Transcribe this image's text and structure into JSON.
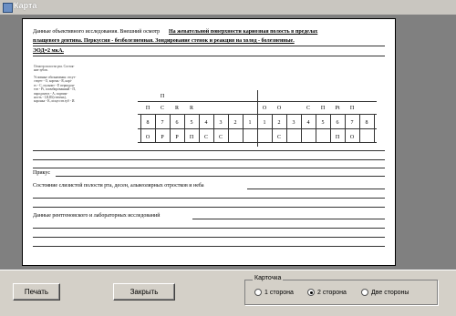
{
  "window": {
    "title": "Карта"
  },
  "card": {
    "exam_prefix": "Данные объективного исследования. Внешний осмотр",
    "exam_line1": "На жевательной поверхности кариозная полость в пределах",
    "exam_line2": "плащевого дентина. Перкуссия - безболезненная. Зондирование стенок и реакция на холод - болезненные.",
    "exam_line3": "ЭОД=2 мкА.",
    "legend_title": "Осмотр полости рта. Состоя-\nние зубов.",
    "legend_body": "Условные обозначения: отсут-\nствует - О, корень - R, карi-\nес - С, пульпит - Р, периодон-\nтит - Pt, пломбированный - П,\nпародонтоз - A, подвиж-\nность - I,II,III(степень),\nкоронка - K, искусств.зуб - И.",
    "teeth_top_status": [
      "",
      "П",
      "",
      "",
      "",
      "",
      "",
      "",
      "",
      "",
      "",
      "",
      "",
      "",
      "",
      ""
    ],
    "teeth_upper_status": [
      "П",
      "С",
      "R",
      "R",
      "",
      "",
      "",
      "",
      "О",
      "О",
      "",
      "С",
      "П",
      "Pt",
      "П",
      ""
    ],
    "teeth_numbers": [
      "8",
      "7",
      "6",
      "5",
      "4",
      "3",
      "2",
      "1",
      "1",
      "2",
      "3",
      "4",
      "5",
      "6",
      "7",
      "8"
    ],
    "teeth_lower_status": [
      "О",
      "Р",
      "Р",
      "П",
      "С",
      "С",
      "",
      "",
      "",
      "С",
      "",
      "",
      "",
      "П",
      "О",
      ""
    ],
    "bite_label": "Прикус",
    "mucosa_label": "Состояние слизистой полости рта, десен, альвеолярных отростков и неба",
    "xray_label": "Данные рентгеновского и лабораторных исследований"
  },
  "controls": {
    "print_label": "Печать",
    "close_label": "Закрыть",
    "card_group_label": "Карточка",
    "radio_options": [
      {
        "label": "1 сторона",
        "checked": false
      },
      {
        "label": "2 сторона",
        "checked": true
      },
      {
        "label": "Две стороны",
        "checked": false
      }
    ]
  }
}
